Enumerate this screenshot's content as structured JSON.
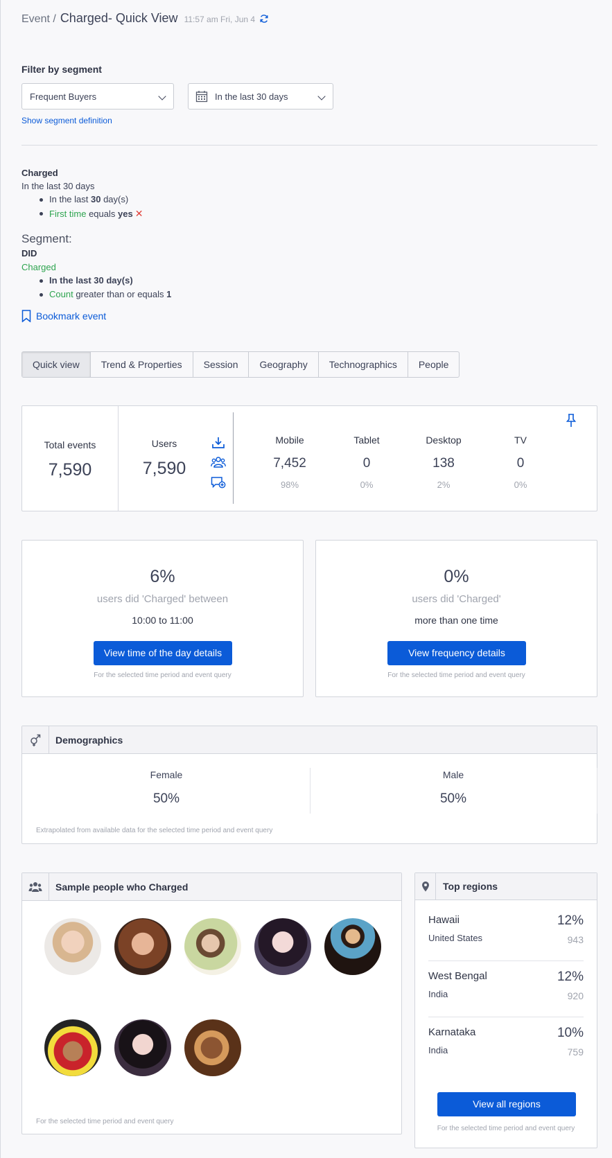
{
  "header": {
    "breadcrumb": "Event /",
    "title": "Charged- Quick View",
    "timestamp": "11:57 am Fri, Jun 4"
  },
  "filter": {
    "label": "Filter by segment",
    "segment_value": "Frequent Buyers",
    "date_value": "In the last 30 days",
    "show_definition": "Show segment definition"
  },
  "query": {
    "event": "Charged",
    "range": "In the last 30 days",
    "c1_pre": "In the last ",
    "c1_num": "30",
    "c1_post": " day(s)",
    "c2_prop": "First time",
    "c2_op": " equals ",
    "c2_val": "yes",
    "remove_glyph": "✕"
  },
  "segment": {
    "heading": "Segment:",
    "did": "DID",
    "event": "Charged",
    "c1": "In the last 30 day(s)",
    "c2_prop": "Count",
    "c2_op": " greater than or equals ",
    "c2_val": "1"
  },
  "bookmark_label": "Bookmark event",
  "tabs": [
    "Quick view",
    "Trend & Properties",
    "Session",
    "Geography",
    "Technographics",
    "People"
  ],
  "stats": {
    "total_label": "Total events",
    "total_value": "7,590",
    "users_label": "Users",
    "users_value": "7,590",
    "devices": [
      {
        "label": "Mobile",
        "value": "7,452",
        "pct": "98%"
      },
      {
        "label": "Tablet",
        "value": "0",
        "pct": "0%"
      },
      {
        "label": "Desktop",
        "value": "138",
        "pct": "2%"
      },
      {
        "label": "TV",
        "value": "0",
        "pct": "0%"
      }
    ]
  },
  "time_card": {
    "pct": "6%",
    "line1": "users did 'Charged' between",
    "line2": "10:00 to 11:00",
    "button": "View time of the day details",
    "footnote": "For the selected time period and event query"
  },
  "freq_card": {
    "pct": "0%",
    "line1": "users did 'Charged'",
    "line2": "more than one time",
    "button": "View frequency details",
    "footnote": "For the selected time period and event query"
  },
  "demographics": {
    "title": "Demographics",
    "female_label": "Female",
    "female_pct": "50%",
    "male_label": "Male",
    "male_pct": "50%",
    "footnote": "Extrapolated from available data for the selected time period and event query"
  },
  "people": {
    "title": "Sample people who Charged",
    "footnote": "For the selected time period and event query"
  },
  "regions": {
    "title": "Top regions",
    "items": [
      {
        "name": "Hawaii",
        "country": "United States",
        "pct": "12%",
        "count": "943"
      },
      {
        "name": "West Bengal",
        "country": "India",
        "pct": "12%",
        "count": "920"
      },
      {
        "name": "Karnataka",
        "country": "India",
        "pct": "10%",
        "count": "759"
      }
    ],
    "button": "View all regions",
    "footnote": "For the selected time period and event query"
  },
  "colors": {
    "accent": "#0b5bd8",
    "property_green": "#2ea44f",
    "remove_red": "#e0413a"
  }
}
